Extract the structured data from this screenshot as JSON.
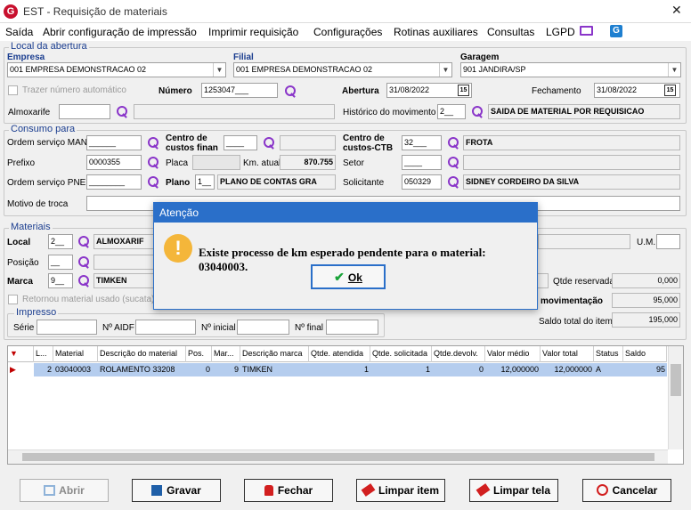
{
  "window": {
    "title": "EST - Requisição de materiais"
  },
  "menu": [
    "Saída",
    "Abrir configuração de impressão",
    "Imprimir requisição",
    "Configurações",
    "Rotinas auxiliares",
    "Consultas",
    "LGPD"
  ],
  "local_abertura": {
    "group_label": "Local da abertura",
    "empresa_label": "Empresa",
    "empresa_value": "001 EMPRESA DEMONSTRACAO 02",
    "filial_label": "Filial",
    "filial_value": "001 EMPRESA DEMONSTRACAO 02",
    "garagem_label": "Garagem",
    "garagem_value": "901 JANDIRA/SP",
    "trazer_label": "Trazer número automático",
    "numero_label": "Número",
    "numero_value": "1253047___",
    "abertura_label": "Abertura",
    "abertura_value": "31/08/2022",
    "fechamento_label": "Fechamento",
    "fechamento_value": "31/08/2022",
    "almoxarife_label": "Almoxarife",
    "historico_label": "Histórico do movimento",
    "historico_code": "2__",
    "historico_desc": "SAIDA DE MATERIAL POR REQUISICAO"
  },
  "consumo": {
    "group_label": "Consumo para",
    "os_man_label": "Ordem serviço MAN",
    "os_man_value": "______",
    "cc_finan_label": "Centro de custos finan",
    "cc_finan_value": "____",
    "cc_ctb_label": "Centro de custos-CTB",
    "cc_ctb_value": "32___",
    "cc_ctb_desc": "FROTA",
    "prefixo_label": "Prefixo",
    "prefixo_value": "0000355",
    "placa_label": "Placa",
    "km_label": "Km. atual",
    "km_value": "870.755",
    "setor_label": "Setor",
    "setor_value": "____",
    "os_pne_label": "Ordem serviço PNE",
    "os_pne_value": "________",
    "plano_label": "Plano",
    "plano_code": "1__",
    "plano_desc": "PLANO DE CONTAS GRA",
    "solicitante_label": "Solicitante",
    "solicitante_value": "050329",
    "solicitante_desc": "SIDNEY CORDEIRO DA SILVA",
    "motivo_label": "Motivo de troca"
  },
  "materiais": {
    "group_label": "Materiais",
    "local_label": "Local",
    "local_code": "2__",
    "local_desc": "ALMOXARIF",
    "posicao_label": "Posição",
    "posicao_value": "__",
    "marca_label": "Marca",
    "marca_code": "9__",
    "marca_desc": "TIMKEN",
    "retornou_label": "Retornou material usado (sucata)",
    "um_label": "U.M.",
    "qtde_reservada_label": "Qtde reservada",
    "qtde_reservada_value": "0,000",
    "movimentacao_label": "movimentação",
    "movimentacao_value": "95,000",
    "saldo_label": "Saldo total do item",
    "saldo_value": "195,000"
  },
  "impresso": {
    "group_label": "Impresso",
    "serie_label": "Série",
    "aidf_label": "Nº AIDF",
    "inicial_label": "Nº inicial",
    "final_label": "Nº final"
  },
  "grid": {
    "headers": [
      "L...",
      "Material",
      "Descrição do material",
      "Pos.",
      "Mar...",
      "Descrição marca",
      "Qtde. atendida",
      "Qtde. solicitada",
      "Qtde.devolv.",
      "Valor médio",
      "Valor total",
      "Status",
      "Saldo"
    ],
    "rows": [
      [
        "2",
        "03040003",
        "ROLAMENTO 33208",
        "0",
        "9",
        "TIMKEN",
        "1",
        "1",
        "0",
        "12,000000",
        "12,000000",
        "A",
        "95"
      ]
    ]
  },
  "buttons": {
    "abrir": "Abrir",
    "gravar": "Gravar",
    "fechar": "Fechar",
    "limpar_item": "Limpar item",
    "limpar_tela": "Limpar tela",
    "cancelar": "Cancelar"
  },
  "dialog": {
    "title": "Atenção",
    "message": "Existe processo de km esperado pendente para o material: 03040003.",
    "ok": "Ok"
  },
  "colors": {
    "accent": "#2a6fc9",
    "selected_row": "#b5cdee",
    "search_icon": "#8a35c9",
    "group_label": "#1a3d8f",
    "warning": "#f4b63a"
  }
}
